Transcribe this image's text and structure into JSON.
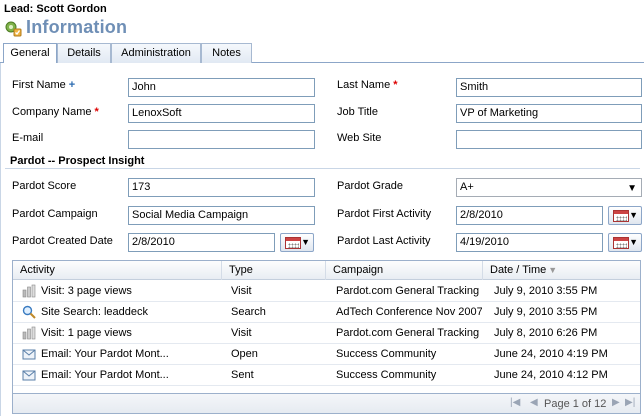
{
  "header": {
    "breadcrumb": "Lead: Scott Gordon",
    "title": "Information"
  },
  "tabs": [
    {
      "label": "General",
      "active": true
    },
    {
      "label": "Details",
      "active": false
    },
    {
      "label": "Administration",
      "active": false
    },
    {
      "label": "Notes",
      "active": false
    }
  ],
  "form": {
    "first_name": {
      "label": "First Name",
      "marker": "+",
      "value": "John"
    },
    "last_name": {
      "label": "Last Name",
      "marker": "*",
      "value": "Smith"
    },
    "company_name": {
      "label": "Company Name",
      "marker": "*",
      "value": "LenoxSoft"
    },
    "job_title": {
      "label": "Job Title",
      "value": "VP of Marketing"
    },
    "email": {
      "label": "E-mail",
      "value": ""
    },
    "website": {
      "label": "Web Site",
      "value": ""
    }
  },
  "pardot": {
    "section_title": "Pardot -- Prospect Insight",
    "score": {
      "label": "Pardot Score",
      "value": "173"
    },
    "grade": {
      "label": "Pardot Grade",
      "value": "A+"
    },
    "campaign": {
      "label": "Pardot Campaign",
      "value": "Social Media Campaign"
    },
    "first_activity": {
      "label": "Pardot First Activity",
      "value": "2/8/2010"
    },
    "created_date": {
      "label": "Pardot Created Date",
      "value": "2/8/2010"
    },
    "last_activity": {
      "label": "Pardot Last Activity",
      "value": "4/19/2010"
    }
  },
  "grid": {
    "columns": [
      "Activity",
      "Type",
      "Campaign",
      "Date / Time"
    ],
    "rows": [
      {
        "activity": "Visit: 3 page views",
        "type": "Visit",
        "campaign": "Pardot.com General Tracking",
        "datetime": "July 9, 2010 3:55 PM",
        "icon": "visit-icon"
      },
      {
        "activity": "Site Search: leaddeck",
        "type": "Search",
        "campaign": "AdTech Conference Nov 2007",
        "datetime": "July 9, 2010 3:55 PM",
        "icon": "search-icon"
      },
      {
        "activity": "Visit: 1 page views",
        "type": "Visit",
        "campaign": "Pardot.com General Tracking",
        "datetime": "July 8, 2010 6:26 PM",
        "icon": "visit-icon"
      },
      {
        "activity": "Email: Your Pardot Mont...",
        "type": "Open",
        "campaign": "Success Community",
        "datetime": "June 24, 2010 4:19 PM",
        "icon": "email-icon"
      },
      {
        "activity": "Email: Your Pardot Mont...",
        "type": "Sent",
        "campaign": "Success Community",
        "datetime": "June 24, 2010 4:12 PM",
        "icon": "email-icon"
      }
    ]
  },
  "pager": {
    "text": "Page 1 of 12",
    "current_page": 1,
    "total_pages": 12
  },
  "colors": {
    "title": "#6f8fb6",
    "required": "#dd0000",
    "recommended": "#2a6ab0",
    "border": "#7f9db9"
  }
}
